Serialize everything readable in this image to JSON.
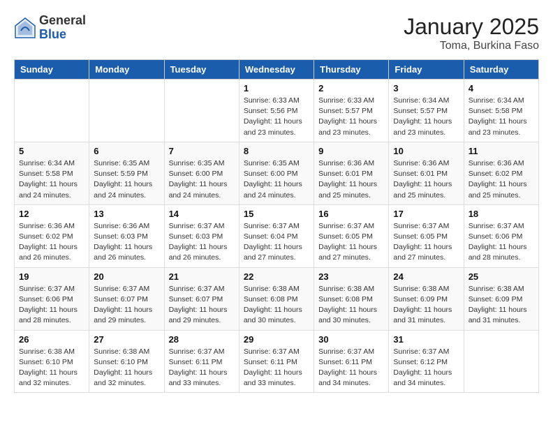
{
  "logo": {
    "general": "General",
    "blue": "Blue"
  },
  "title": "January 2025",
  "location": "Toma, Burkina Faso",
  "weekdays": [
    "Sunday",
    "Monday",
    "Tuesday",
    "Wednesday",
    "Thursday",
    "Friday",
    "Saturday"
  ],
  "weeks": [
    [
      {
        "day": "",
        "info": ""
      },
      {
        "day": "",
        "info": ""
      },
      {
        "day": "",
        "info": ""
      },
      {
        "day": "1",
        "info": "Sunrise: 6:33 AM\nSunset: 5:56 PM\nDaylight: 11 hours\nand 23 minutes."
      },
      {
        "day": "2",
        "info": "Sunrise: 6:33 AM\nSunset: 5:57 PM\nDaylight: 11 hours\nand 23 minutes."
      },
      {
        "day": "3",
        "info": "Sunrise: 6:34 AM\nSunset: 5:57 PM\nDaylight: 11 hours\nand 23 minutes."
      },
      {
        "day": "4",
        "info": "Sunrise: 6:34 AM\nSunset: 5:58 PM\nDaylight: 11 hours\nand 23 minutes."
      }
    ],
    [
      {
        "day": "5",
        "info": "Sunrise: 6:34 AM\nSunset: 5:58 PM\nDaylight: 11 hours\nand 24 minutes."
      },
      {
        "day": "6",
        "info": "Sunrise: 6:35 AM\nSunset: 5:59 PM\nDaylight: 11 hours\nand 24 minutes."
      },
      {
        "day": "7",
        "info": "Sunrise: 6:35 AM\nSunset: 6:00 PM\nDaylight: 11 hours\nand 24 minutes."
      },
      {
        "day": "8",
        "info": "Sunrise: 6:35 AM\nSunset: 6:00 PM\nDaylight: 11 hours\nand 24 minutes."
      },
      {
        "day": "9",
        "info": "Sunrise: 6:36 AM\nSunset: 6:01 PM\nDaylight: 11 hours\nand 25 minutes."
      },
      {
        "day": "10",
        "info": "Sunrise: 6:36 AM\nSunset: 6:01 PM\nDaylight: 11 hours\nand 25 minutes."
      },
      {
        "day": "11",
        "info": "Sunrise: 6:36 AM\nSunset: 6:02 PM\nDaylight: 11 hours\nand 25 minutes."
      }
    ],
    [
      {
        "day": "12",
        "info": "Sunrise: 6:36 AM\nSunset: 6:02 PM\nDaylight: 11 hours\nand 26 minutes."
      },
      {
        "day": "13",
        "info": "Sunrise: 6:36 AM\nSunset: 6:03 PM\nDaylight: 11 hours\nand 26 minutes."
      },
      {
        "day": "14",
        "info": "Sunrise: 6:37 AM\nSunset: 6:03 PM\nDaylight: 11 hours\nand 26 minutes."
      },
      {
        "day": "15",
        "info": "Sunrise: 6:37 AM\nSunset: 6:04 PM\nDaylight: 11 hours\nand 27 minutes."
      },
      {
        "day": "16",
        "info": "Sunrise: 6:37 AM\nSunset: 6:05 PM\nDaylight: 11 hours\nand 27 minutes."
      },
      {
        "day": "17",
        "info": "Sunrise: 6:37 AM\nSunset: 6:05 PM\nDaylight: 11 hours\nand 27 minutes."
      },
      {
        "day": "18",
        "info": "Sunrise: 6:37 AM\nSunset: 6:06 PM\nDaylight: 11 hours\nand 28 minutes."
      }
    ],
    [
      {
        "day": "19",
        "info": "Sunrise: 6:37 AM\nSunset: 6:06 PM\nDaylight: 11 hours\nand 28 minutes."
      },
      {
        "day": "20",
        "info": "Sunrise: 6:37 AM\nSunset: 6:07 PM\nDaylight: 11 hours\nand 29 minutes."
      },
      {
        "day": "21",
        "info": "Sunrise: 6:37 AM\nSunset: 6:07 PM\nDaylight: 11 hours\nand 29 minutes."
      },
      {
        "day": "22",
        "info": "Sunrise: 6:38 AM\nSunset: 6:08 PM\nDaylight: 11 hours\nand 30 minutes."
      },
      {
        "day": "23",
        "info": "Sunrise: 6:38 AM\nSunset: 6:08 PM\nDaylight: 11 hours\nand 30 minutes."
      },
      {
        "day": "24",
        "info": "Sunrise: 6:38 AM\nSunset: 6:09 PM\nDaylight: 11 hours\nand 31 minutes."
      },
      {
        "day": "25",
        "info": "Sunrise: 6:38 AM\nSunset: 6:09 PM\nDaylight: 11 hours\nand 31 minutes."
      }
    ],
    [
      {
        "day": "26",
        "info": "Sunrise: 6:38 AM\nSunset: 6:10 PM\nDaylight: 11 hours\nand 32 minutes."
      },
      {
        "day": "27",
        "info": "Sunrise: 6:38 AM\nSunset: 6:10 PM\nDaylight: 11 hours\nand 32 minutes."
      },
      {
        "day": "28",
        "info": "Sunrise: 6:37 AM\nSunset: 6:11 PM\nDaylight: 11 hours\nand 33 minutes."
      },
      {
        "day": "29",
        "info": "Sunrise: 6:37 AM\nSunset: 6:11 PM\nDaylight: 11 hours\nand 33 minutes."
      },
      {
        "day": "30",
        "info": "Sunrise: 6:37 AM\nSunset: 6:11 PM\nDaylight: 11 hours\nand 34 minutes."
      },
      {
        "day": "31",
        "info": "Sunrise: 6:37 AM\nSunset: 6:12 PM\nDaylight: 11 hours\nand 34 minutes."
      },
      {
        "day": "",
        "info": ""
      }
    ]
  ]
}
